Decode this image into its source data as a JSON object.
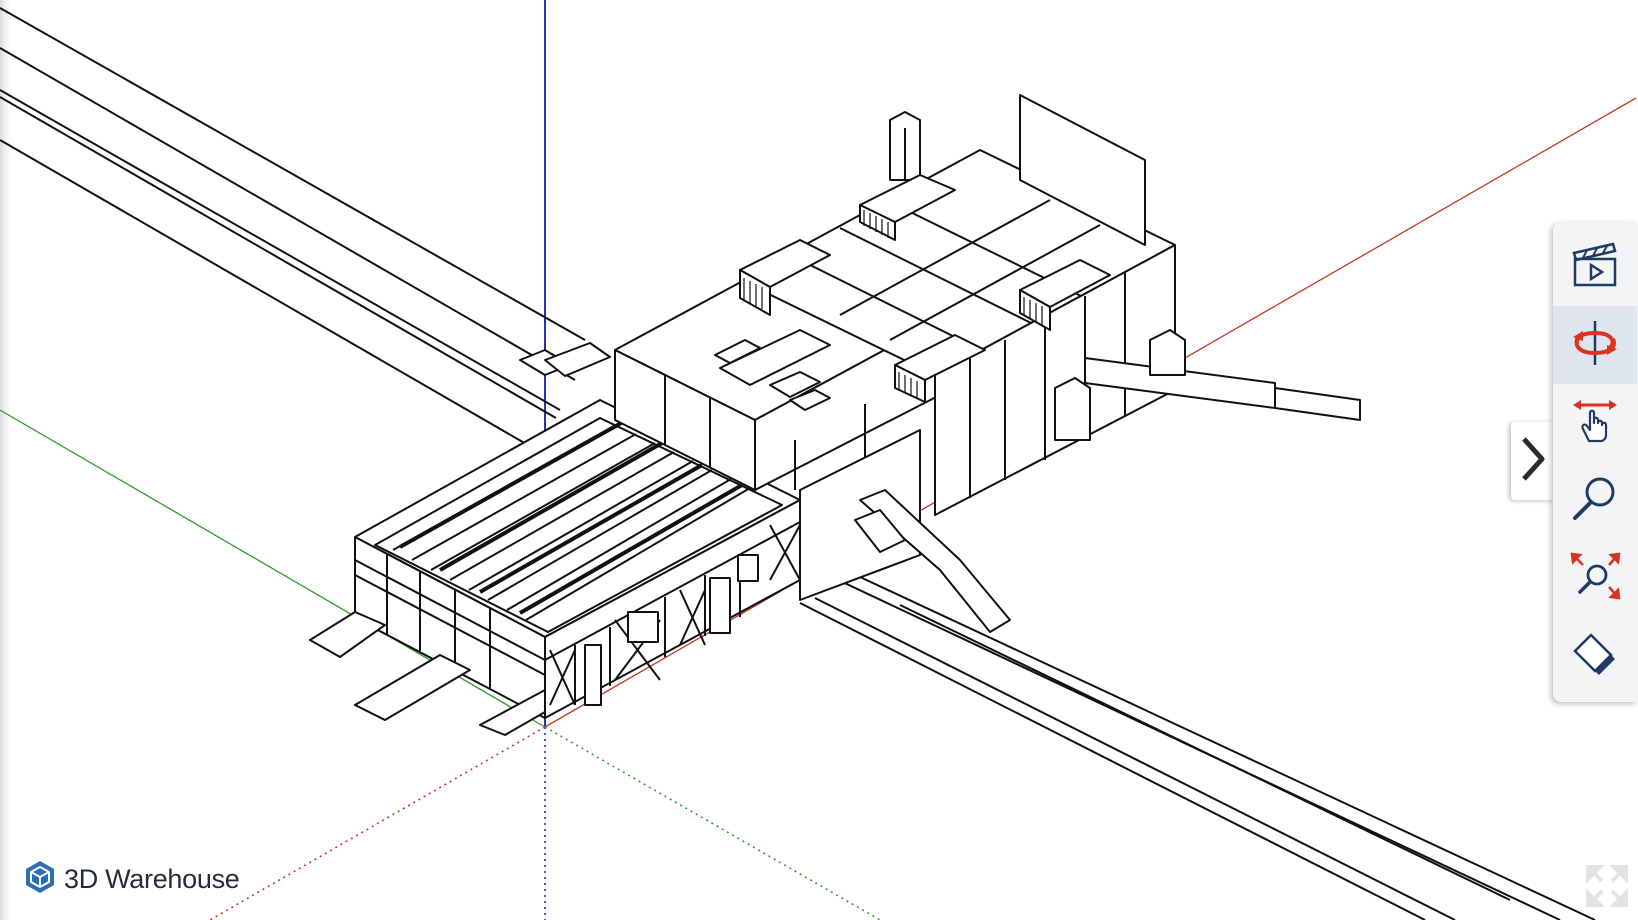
{
  "brand": {
    "name": "3D Warehouse",
    "logo_icon": "warehouse-cube-icon"
  },
  "viewer": {
    "axes_colors": {
      "red": "#c0392b",
      "green": "#2e9e2e",
      "blue": "#2c2cb8"
    },
    "toolbar": {
      "tools": [
        {
          "name": "scenes",
          "icon": "clapperboard-icon",
          "active": false
        },
        {
          "name": "orbit",
          "icon": "orbit-icon",
          "active": true
        },
        {
          "name": "pan",
          "icon": "pan-hand-icon",
          "active": false
        },
        {
          "name": "zoom",
          "icon": "magnifier-icon",
          "active": false
        },
        {
          "name": "zoom-extents",
          "icon": "zoom-extents-icon",
          "active": false
        },
        {
          "name": "styles",
          "icon": "style-eraser-icon",
          "active": false
        }
      ],
      "collapse_icon": "chevron-right-icon"
    },
    "fullscreen_icon": "expand-arrows-icon"
  }
}
